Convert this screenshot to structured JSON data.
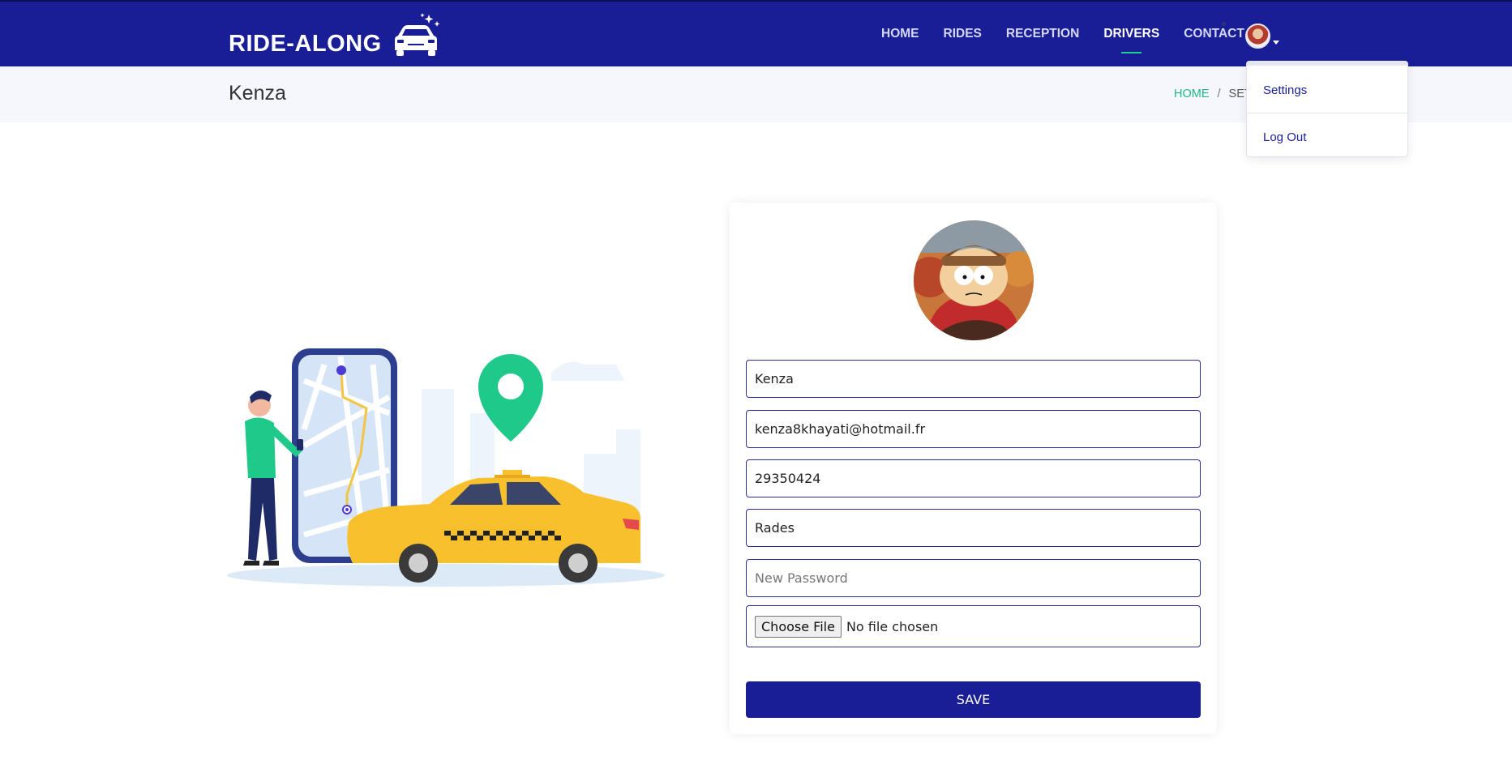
{
  "brand": {
    "name": "RIDE-ALONG",
    "logo_icon": "car-icon"
  },
  "nav": {
    "items": [
      {
        "label": "HOME",
        "active": false
      },
      {
        "label": "RIDES",
        "active": false
      },
      {
        "label": "RECEPTION",
        "active": false
      },
      {
        "label": "DRIVERS",
        "active": true
      },
      {
        "label": "CONTACT",
        "active": false
      }
    ]
  },
  "user_menu": {
    "items": [
      {
        "label": "Settings"
      },
      {
        "label": "Log Out"
      }
    ]
  },
  "header": {
    "title": "Kenza",
    "breadcrumb": {
      "home": "HOME",
      "separator": "/",
      "current": "SETTINGS"
    }
  },
  "form": {
    "name": "Kenza",
    "email": "kenza8khayati@hotmail.fr",
    "phone": "29350424",
    "city": "Rades",
    "password_placeholder": "New Password",
    "file_button": "Choose File",
    "file_status": "No file chosen",
    "save_label": "SAVE"
  },
  "colors": {
    "primary": "#1a1e96",
    "accent": "#1fd18f",
    "taxi": "#f9c02e",
    "pin": "#1fc98a"
  }
}
